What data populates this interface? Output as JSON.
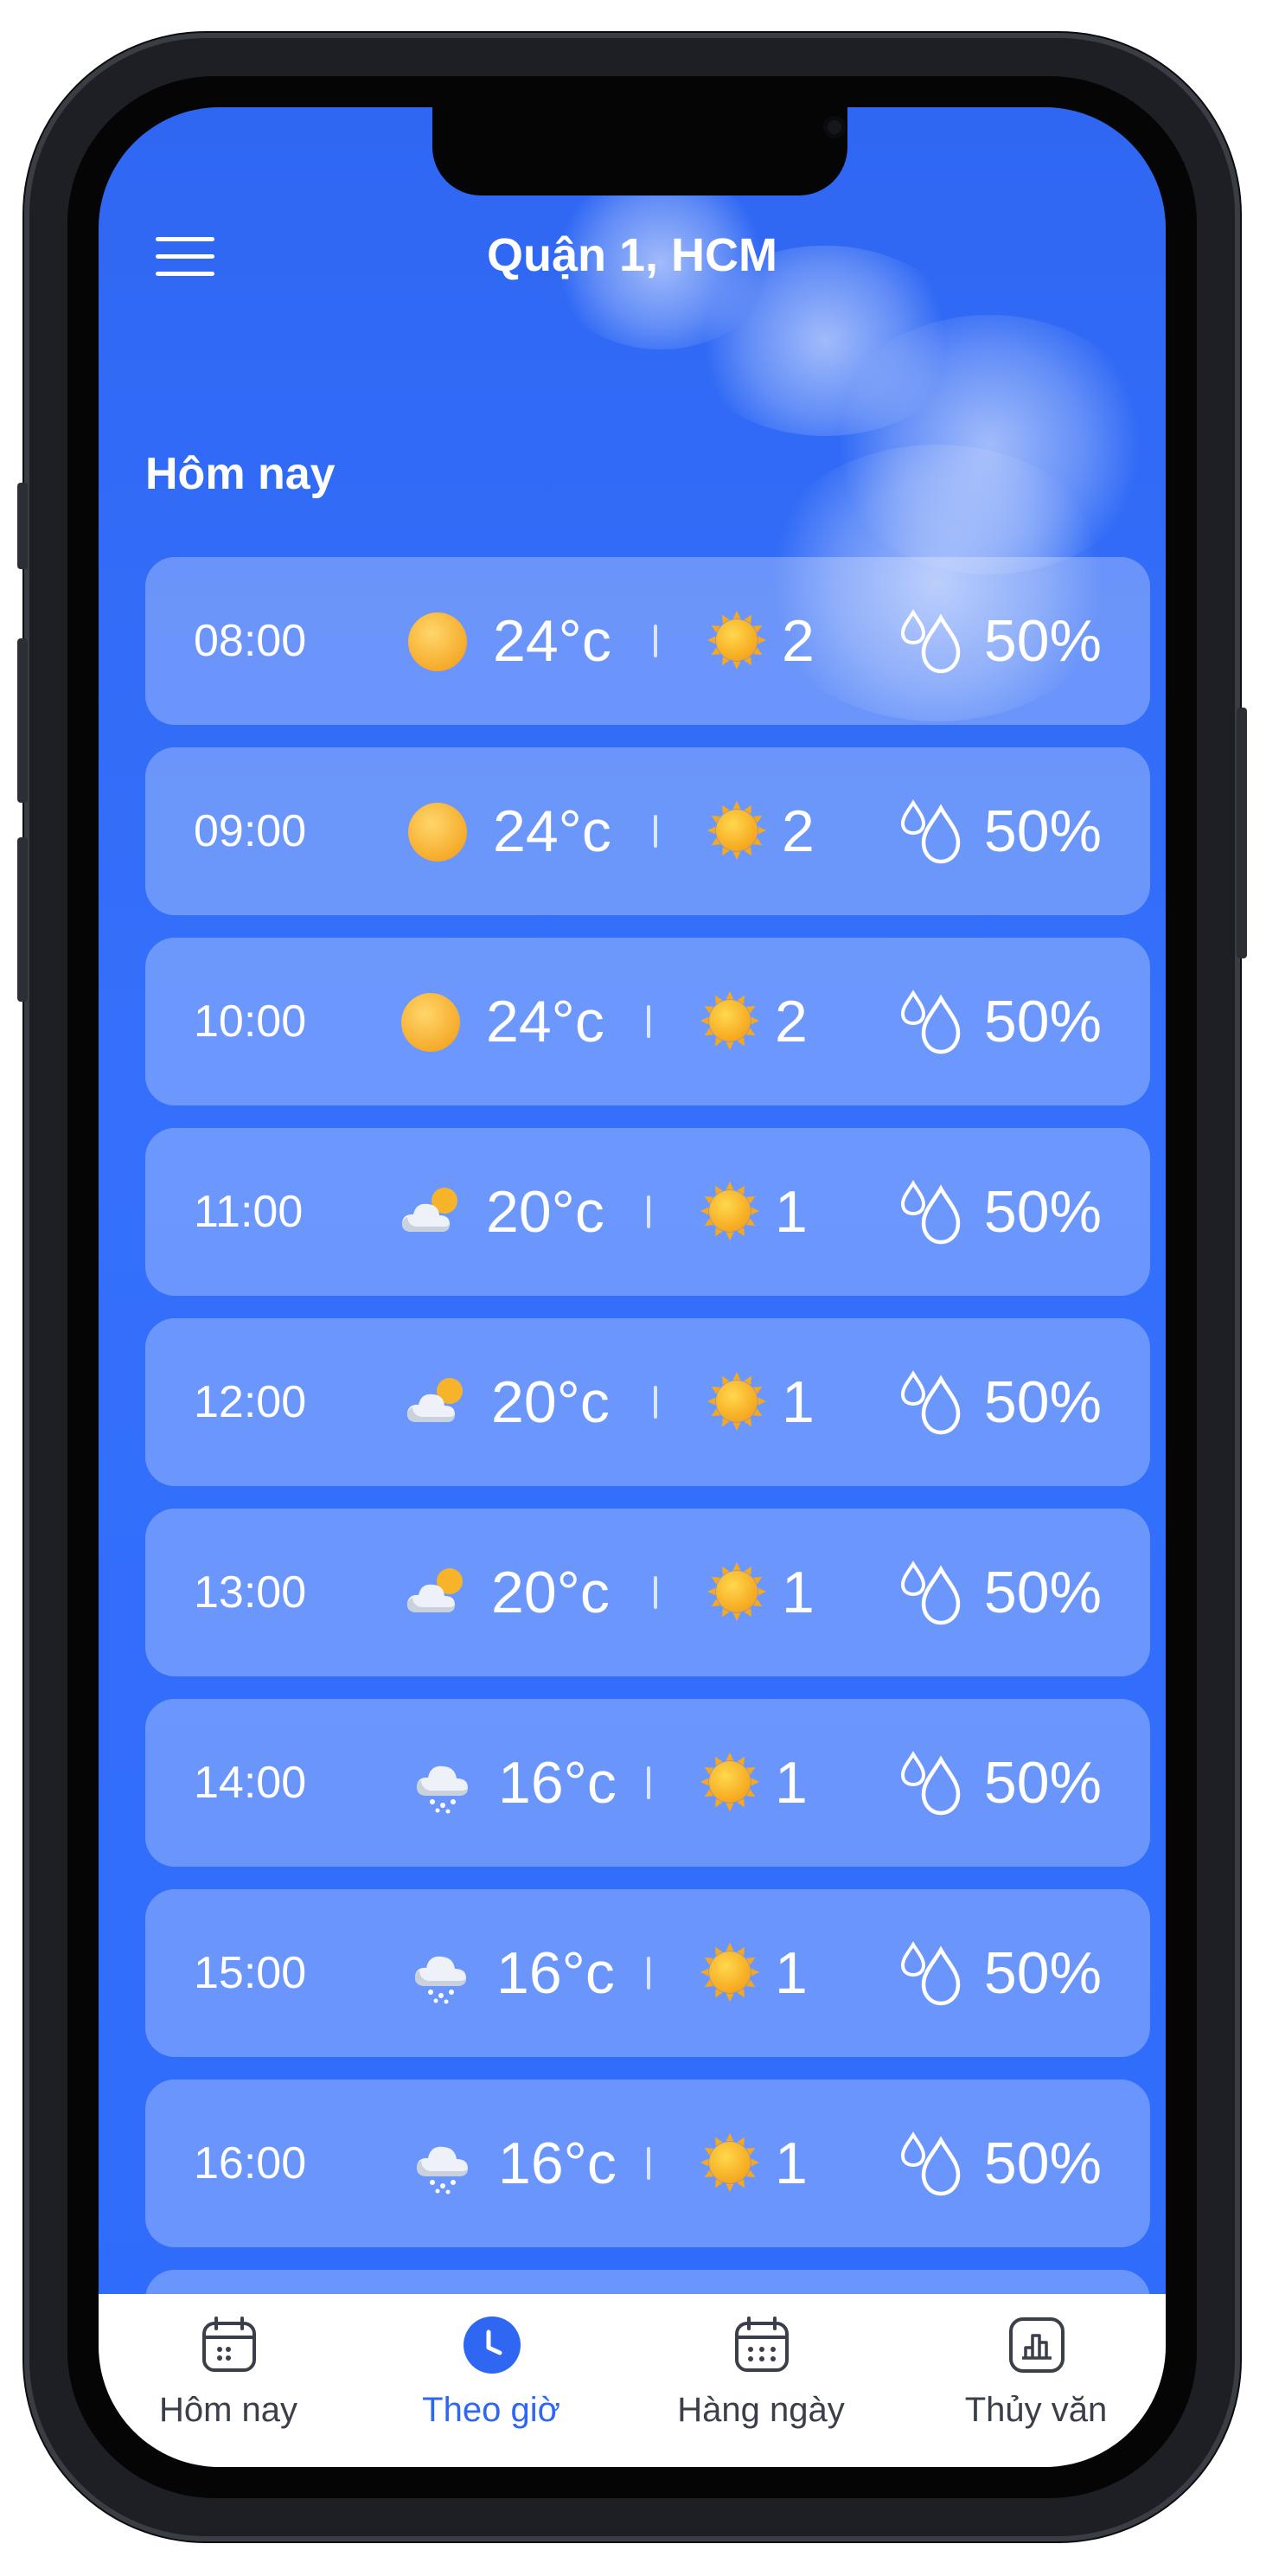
{
  "header": {
    "location": "Quận 1, HCM"
  },
  "section_title": "Hôm nay",
  "rows": [
    {
      "time": "08:00",
      "icon": "sun",
      "temp": "24°c",
      "uv": "2",
      "humidity": "50%"
    },
    {
      "time": "09:00",
      "icon": "sun",
      "temp": "24°c",
      "uv": "2",
      "humidity": "50%"
    },
    {
      "time": "10:00",
      "icon": "sun",
      "temp": "24°c",
      "uv": "2",
      "humidity": "50%"
    },
    {
      "time": "11:00",
      "icon": "partly-cloudy",
      "temp": "20°c",
      "uv": "1",
      "humidity": "50%"
    },
    {
      "time": "12:00",
      "icon": "partly-cloudy",
      "temp": "20°c",
      "uv": "1",
      "humidity": "50%"
    },
    {
      "time": "13:00",
      "icon": "partly-cloudy",
      "temp": "20°c",
      "uv": "1",
      "humidity": "50%"
    },
    {
      "time": "14:00",
      "icon": "snow-cloud",
      "temp": "16°c",
      "uv": "1",
      "humidity": "50%"
    },
    {
      "time": "15:00",
      "icon": "snow-cloud",
      "temp": "16°c",
      "uv": "1",
      "humidity": "50%"
    },
    {
      "time": "16:00",
      "icon": "snow-cloud",
      "temp": "16°c",
      "uv": "1",
      "humidity": "50%"
    }
  ],
  "tabs": [
    {
      "label": "Hôm nay",
      "icon": "calendar-day-icon",
      "active": false
    },
    {
      "label": "Theo giờ",
      "icon": "clock-icon",
      "active": true
    },
    {
      "label": "Hàng ngày",
      "icon": "calendar-grid-icon",
      "active": false
    },
    {
      "label": "Thủy văn",
      "icon": "chart-icon",
      "active": false
    }
  ],
  "colors": {
    "background": "#3470fb",
    "accent": "#2f67f3",
    "sun": "#f7b329",
    "tab_text": "#3a3f4a"
  }
}
